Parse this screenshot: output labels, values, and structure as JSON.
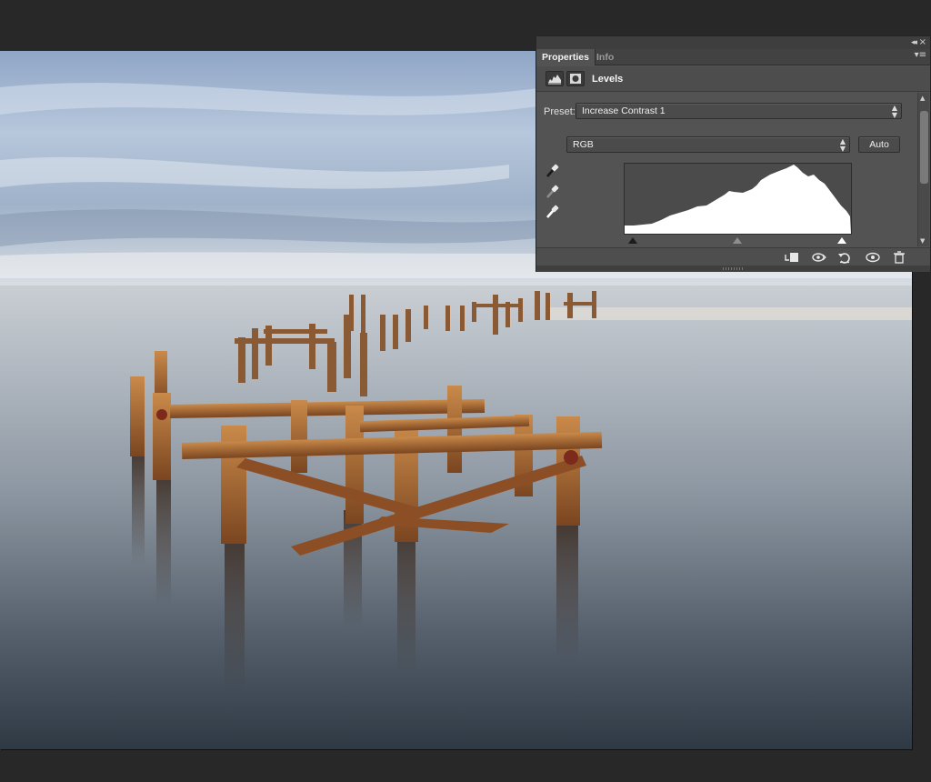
{
  "panel": {
    "tabs": [
      {
        "label": "Properties",
        "active": true
      },
      {
        "label": "Info",
        "active": false
      }
    ],
    "adjustment_title": "Levels",
    "preset_label": "Preset:",
    "preset_value": "Increase Contrast 1",
    "channel_value": "RGB",
    "auto_label": "Auto"
  },
  "icons": [
    "collapse-panels-icon",
    "close-panel-icon",
    "panel-menu-icon",
    "levels-icon",
    "layer-mask-icon",
    "black-point-eyedropper-icon",
    "gray-point-eyedropper-icon",
    "white-point-eyedropper-icon",
    "clip-to-layer-icon",
    "view-previous-state-icon",
    "reset-icon",
    "visibility-eye-icon",
    "trash-icon"
  ],
  "colors": {
    "panel_bg": "#535353",
    "workspace_bg": "#282828",
    "histogram_fill": "#ffffff"
  }
}
